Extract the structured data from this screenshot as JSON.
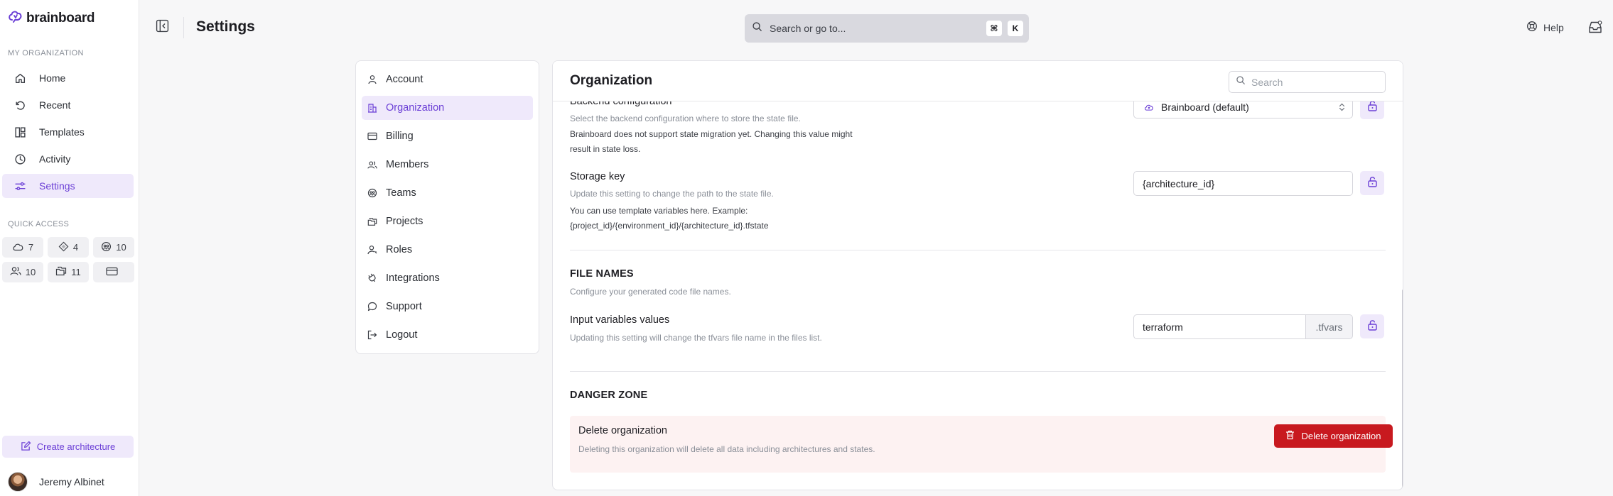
{
  "brand": {
    "name": "brainboard",
    "accent": "#6b3fd6",
    "danger": "#c8191f"
  },
  "sidebar": {
    "org_label": "MY ORGANIZATION",
    "items": [
      {
        "label": "Home",
        "icon": "home-icon"
      },
      {
        "label": "Recent",
        "icon": "history-icon"
      },
      {
        "label": "Templates",
        "icon": "templates-icon"
      },
      {
        "label": "Activity",
        "icon": "clock-icon"
      },
      {
        "label": "Settings",
        "icon": "sliders-icon",
        "active": true
      }
    ],
    "quick_access_label": "QUICK ACCESS",
    "quick_access": [
      {
        "icon": "cloud-icon",
        "count": "7"
      },
      {
        "icon": "diamond-icon",
        "count": "4"
      },
      {
        "icon": "teams-icon",
        "count": "10"
      },
      {
        "icon": "members-icon",
        "count": "10"
      },
      {
        "icon": "projects-icon",
        "count": "11"
      },
      {
        "icon": "card-icon",
        "count": ""
      }
    ],
    "create_label": "Create architecture",
    "user_name": "Jeremy Albinet"
  },
  "header": {
    "title": "Settings",
    "search_placeholder": "Search or go to...",
    "shortcut": [
      "⌘",
      "K"
    ],
    "help_label": "Help"
  },
  "settings_menu": [
    {
      "label": "Account",
      "icon": "user-icon"
    },
    {
      "label": "Organization",
      "icon": "building-icon",
      "active": true
    },
    {
      "label": "Billing",
      "icon": "card-icon"
    },
    {
      "label": "Members",
      "icon": "members-icon"
    },
    {
      "label": "Teams",
      "icon": "teams-icon"
    },
    {
      "label": "Projects",
      "icon": "folder-icon"
    },
    {
      "label": "Roles",
      "icon": "role-icon"
    },
    {
      "label": "Integrations",
      "icon": "plug-icon"
    },
    {
      "label": "Support",
      "icon": "chat-icon"
    },
    {
      "label": "Logout",
      "icon": "logout-icon"
    }
  ],
  "panel": {
    "title": "Organization",
    "search_placeholder": "Search",
    "backend": {
      "title": "Backend configuration",
      "desc": "Select the backend configuration where to store the state file.",
      "note_line1": "Brainboard does not support state migration yet. Changing this value might",
      "note_line2": "result in state loss.",
      "value": "Brainboard (default)"
    },
    "storage": {
      "title": "Storage key",
      "desc": "Update this setting to change the path to the state file.",
      "note_line1": "You can use template variables here. Example:",
      "note_line2": "{project_id}/{environment_id}/{architecture_id}.tfstate",
      "value": "{architecture_id}"
    },
    "file_names": {
      "heading": "FILE NAMES",
      "desc": "Configure your generated code file names.",
      "input_title": "Input variables values",
      "input_desc": "Updating this setting will change the tfvars file name in the files list.",
      "value": "terraform",
      "suffix": ".tfvars"
    },
    "danger": {
      "heading": "DANGER ZONE",
      "title": "Delete organization",
      "desc": "Deleting this organization will delete all data including architectures and states.",
      "button": "Delete organization"
    }
  }
}
